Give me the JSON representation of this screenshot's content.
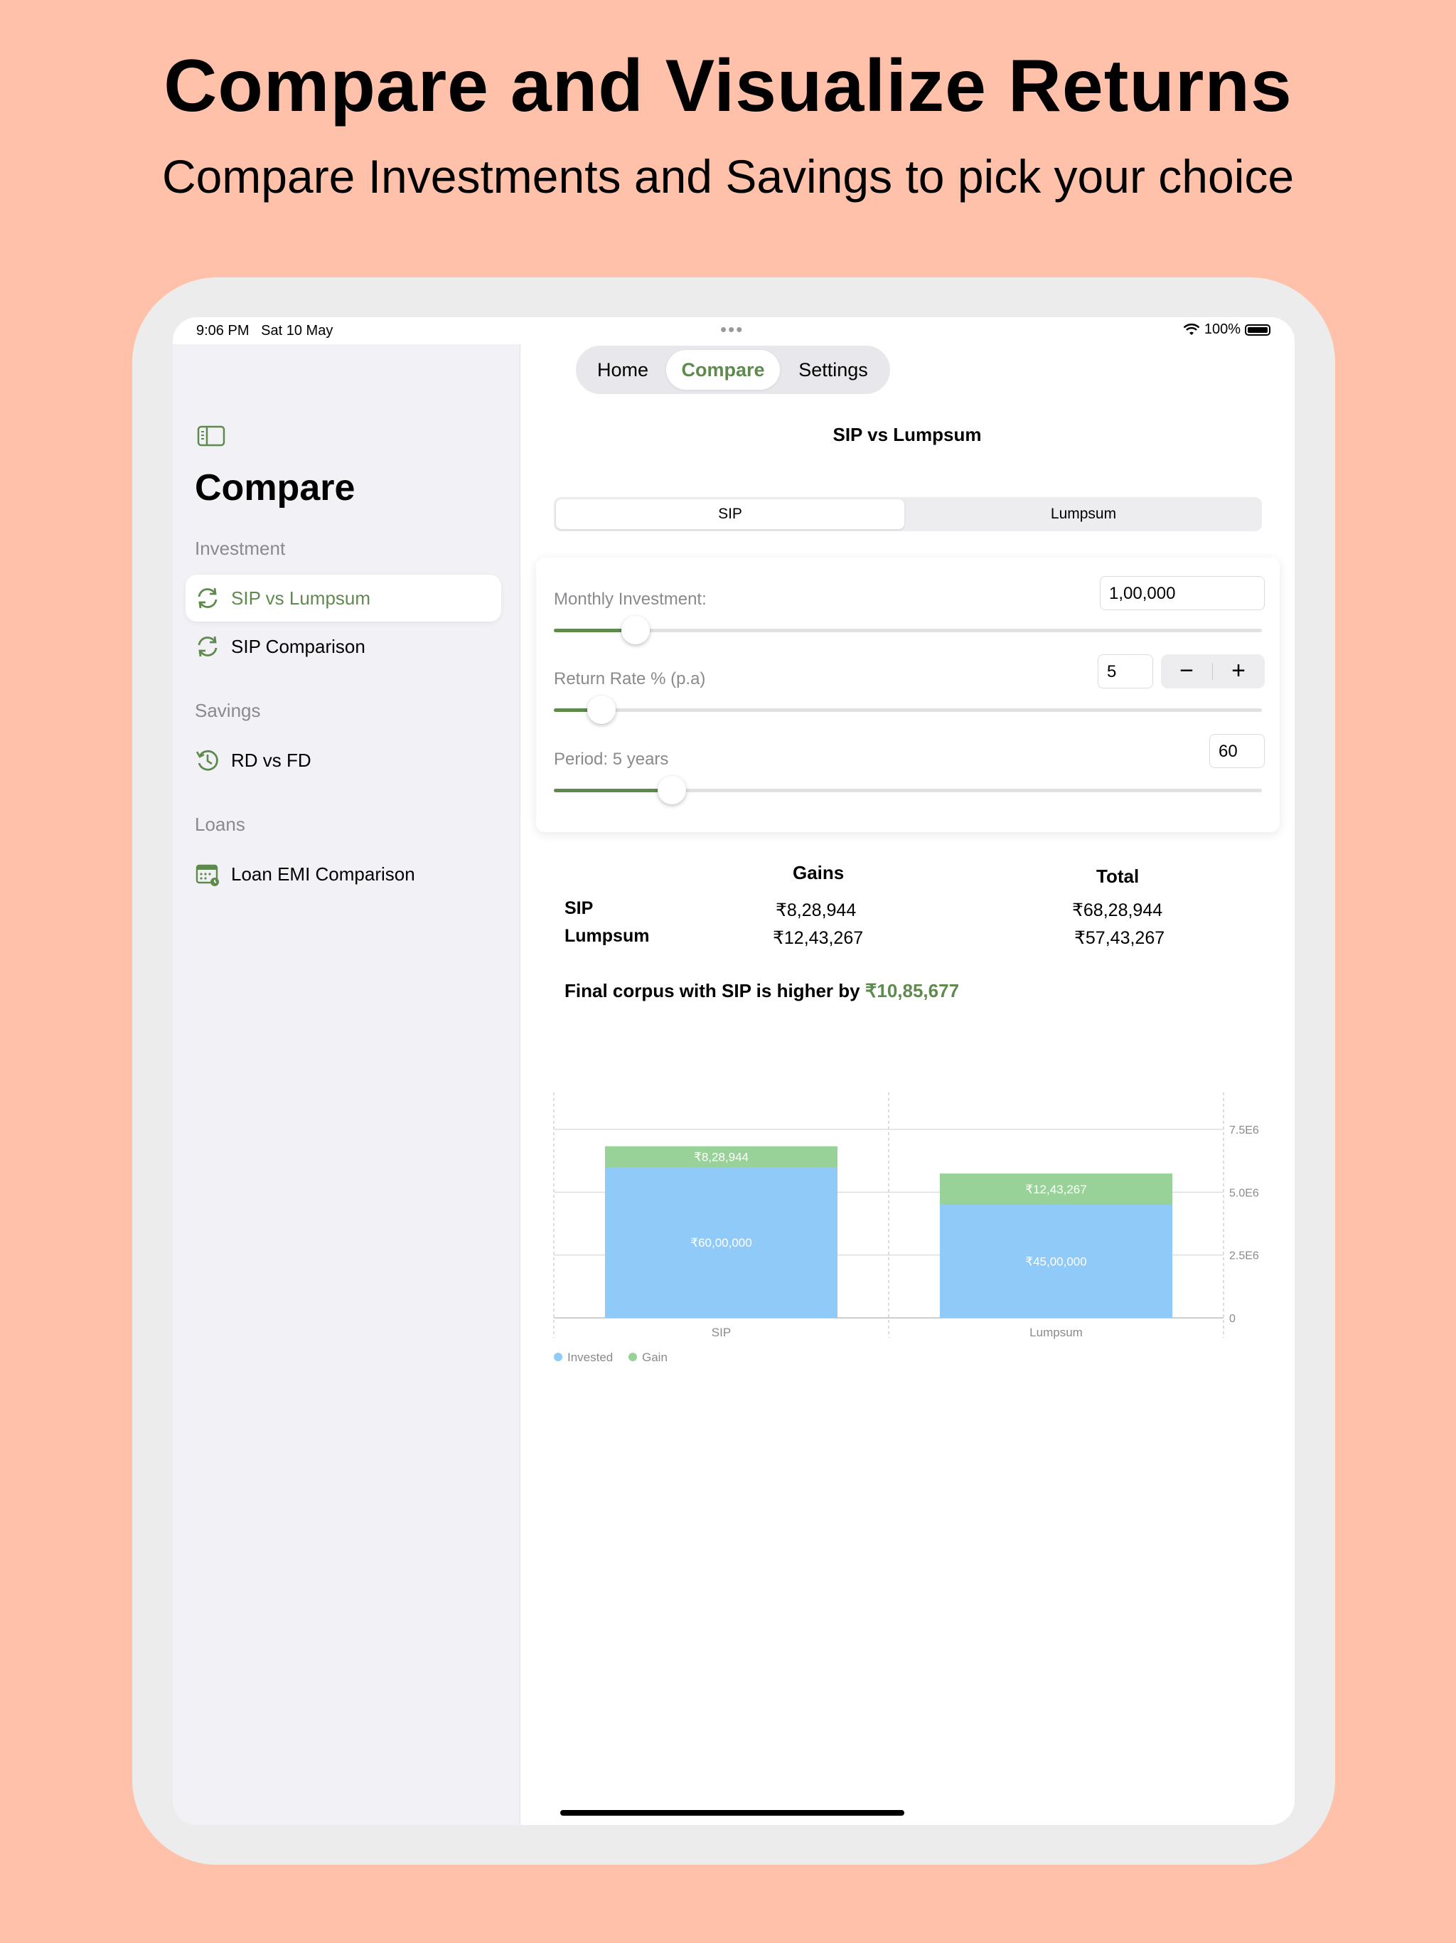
{
  "hero": {
    "title": "Compare and Visualize Returns",
    "subtitle": "Compare Investments and Savings to pick your choice"
  },
  "status_bar": {
    "time": "9:06 PM",
    "date": "Sat 10 May",
    "battery": "100%"
  },
  "tabs": [
    {
      "label": "Home",
      "selected": false
    },
    {
      "label": "Compare",
      "selected": true
    },
    {
      "label": "Settings",
      "selected": false
    }
  ],
  "sidebar": {
    "title": "Compare",
    "sections": [
      {
        "label": "Investment",
        "items": [
          {
            "label": "SIP vs Lumpsum",
            "icon": "refresh-icon",
            "active": true
          },
          {
            "label": "SIP Comparison",
            "icon": "refresh-icon",
            "active": false
          }
        ]
      },
      {
        "label": "Savings",
        "items": [
          {
            "label": "RD vs FD",
            "icon": "history-icon",
            "active": false
          }
        ]
      },
      {
        "label": "Loans",
        "items": [
          {
            "label": "Loan EMI Comparison",
            "icon": "calendar-icon",
            "active": false
          }
        ]
      }
    ]
  },
  "main": {
    "title": "SIP vs Lumpsum",
    "segment": {
      "options": [
        "SIP",
        "Lumpsum"
      ],
      "selected": "SIP"
    },
    "inputs": {
      "monthly_investment": {
        "label": "Monthly Investment:",
        "value": "1,00,000",
        "slider_fraction": 0.115
      },
      "return_rate": {
        "label": "Return Rate % (p.a)",
        "value": "5",
        "minus": "−",
        "plus": "+",
        "slider_fraction": 0.067
      },
      "period": {
        "label": "Period: 5 years",
        "value": "60",
        "slider_fraction": 0.167
      }
    },
    "results": {
      "headers": {
        "gains": "Gains",
        "total": "Total"
      },
      "rows": [
        {
          "name": "SIP",
          "gains": "₹8,28,944",
          "total": "₹68,28,944"
        },
        {
          "name": "Lumpsum",
          "gains": "₹12,43,267",
          "total": "₹57,43,267"
        }
      ]
    },
    "corpus": {
      "text": "Final corpus with SIP is higher by ",
      "amount": "₹10,85,677"
    }
  },
  "colors": {
    "accent": "#5F8A4D",
    "invested": "#90CAF9",
    "gain": "#98D298",
    "background": "#FFC1A9"
  },
  "chart_data": {
    "type": "bar",
    "stacked": true,
    "categories": [
      "SIP",
      "Lumpsum"
    ],
    "series": [
      {
        "name": "Invested",
        "values": [
          6000000,
          4500000
        ],
        "labels": [
          "₹60,00,000",
          "₹45,00,000"
        ],
        "color": "#90CAF9"
      },
      {
        "name": "Gain",
        "values": [
          828944,
          1243267
        ],
        "labels": [
          "₹8,28,944",
          "₹12,43,267"
        ],
        "color": "#98D298"
      }
    ],
    "ylim": [
      0,
      7500000
    ],
    "yticks": [
      0,
      2500000,
      5000000,
      7500000
    ],
    "ytick_labels": [
      "0",
      "2.5E6",
      "5.0E6",
      "7.5E6"
    ],
    "y_axis_side": "right",
    "legend": "bottom-left",
    "grid": true
  }
}
